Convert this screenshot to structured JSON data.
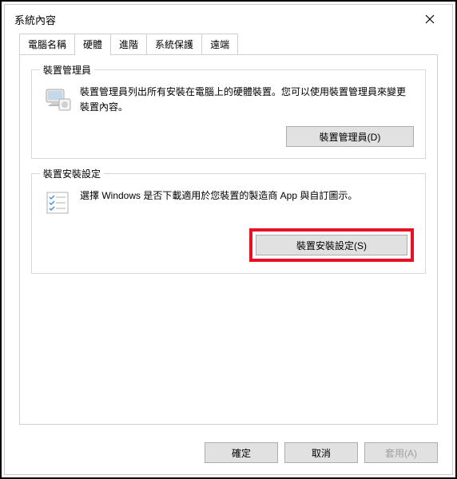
{
  "window": {
    "title": "系統內容"
  },
  "tabs": [
    {
      "label": "電腦名稱"
    },
    {
      "label": "硬體"
    },
    {
      "label": "進階"
    },
    {
      "label": "系統保護"
    },
    {
      "label": "遠端"
    }
  ],
  "activeTab": 1,
  "group1": {
    "title": "裝置管理員",
    "text": "裝置管理員列出所有安裝在電腦上的硬體裝置。您可以使用裝置管理員來變更裝置內容。",
    "button": "裝置管理員(D)"
  },
  "group2": {
    "title": "裝置安裝設定",
    "text": "選擇 Windows 是否下載適用於您裝置的製造商 App 與自訂圖示。",
    "button": "裝置安裝設定(S)"
  },
  "footer": {
    "ok": "確定",
    "cancel": "取消",
    "apply": "套用(A)"
  }
}
